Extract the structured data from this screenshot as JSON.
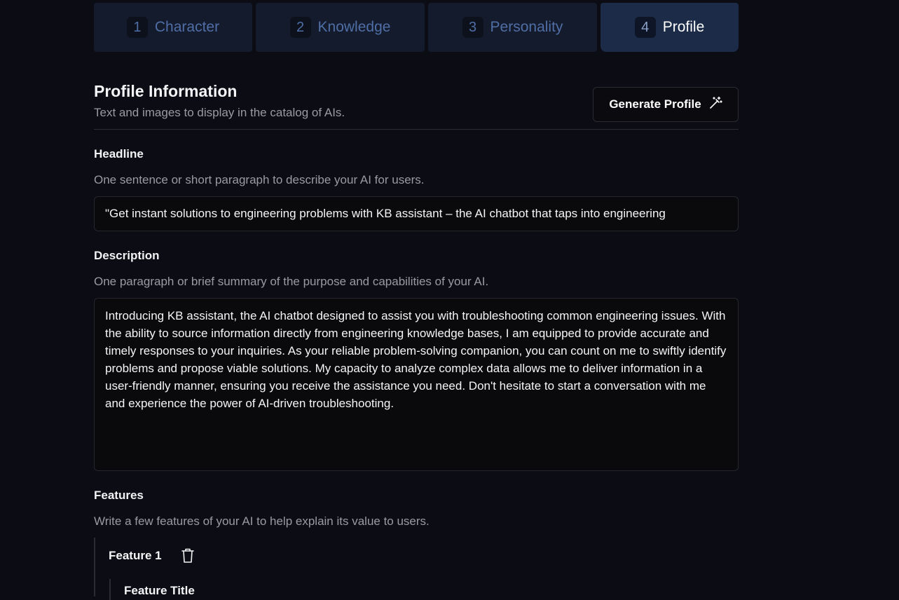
{
  "tabs": [
    {
      "number": "1",
      "label": "Character"
    },
    {
      "number": "2",
      "label": "Knowledge"
    },
    {
      "number": "3",
      "label": "Personality"
    },
    {
      "number": "4",
      "label": "Profile"
    }
  ],
  "active_tab": "Profile",
  "profile": {
    "title": "Profile Information",
    "subtitle": "Text and images to display in the catalog of AIs.",
    "generate_button_label": "Generate Profile",
    "generate_button_icon": "magic-wand-icon"
  },
  "headline": {
    "label": "Headline",
    "help": "One sentence or short paragraph to describe your AI for users.",
    "value": "\"Get instant solutions to engineering problems with KB assistant – the AI chatbot that taps into engineering"
  },
  "description": {
    "label": "Description",
    "help": "One paragraph or brief summary of the purpose and capabilities of your AI.",
    "value": "Introducing KB assistant, the AI chatbot designed to assist you with troubleshooting common engineering issues. With the ability to source information directly from engineering knowledge bases, I am equipped to provide accurate and timely responses to your inquiries. As your reliable problem-solving companion, you can count on me to swiftly identify problems and propose viable solutions. My capacity to analyze complex data allows me to deliver information in a user-friendly manner, ensuring you receive the assistance you need. Don't hesitate to start a conversation with me and experience the power of AI-driven troubleshooting."
  },
  "features": {
    "label": "Features",
    "help": "Write a few features of your AI to help explain its value to users.",
    "items": [
      {
        "heading": "Feature 1",
        "title_label": "Feature Title",
        "delete_icon": "trash-icon"
      }
    ]
  },
  "colors": {
    "background": "#0c0d14",
    "tab_inactive": "#141b2c",
    "tab_active": "#1c2b48",
    "tab_text_inactive": "#4f6ea6",
    "input_background": "#0a0a0c"
  }
}
